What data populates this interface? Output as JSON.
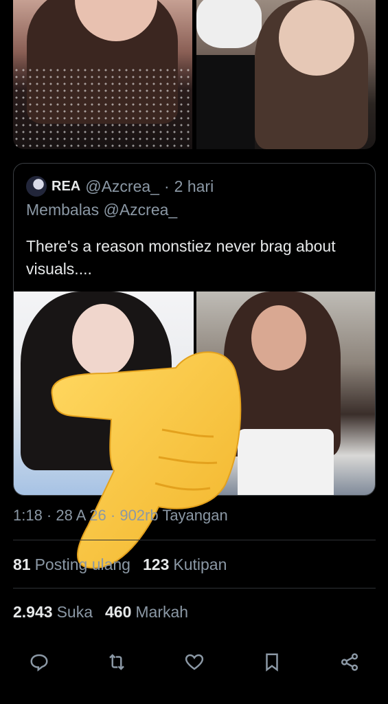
{
  "quote": {
    "display_name": "REA",
    "handle": "@Azcrea_",
    "separator": "·",
    "time": "2 hari",
    "reply_to": "Membalas @Azcrea_",
    "text": "There's a reason monstiez never brag about visuals...."
  },
  "meta": {
    "timestamp": "1:18 · 28 A   26 · 902rb Tayangan"
  },
  "stats": {
    "reposts_count": "81",
    "reposts_label": "Posting ulang",
    "quotes_count": "123",
    "quotes_label": "Kutipan",
    "likes_count": "2.943",
    "likes_label": "Suka",
    "bookmarks_count": "460",
    "bookmarks_label": "Markah"
  },
  "actions": {
    "reply_icon": "reply-icon",
    "repost_icon": "repost-icon",
    "like_icon": "heart-icon",
    "bookmark_icon": "bookmark-icon",
    "share_icon": "share-icon"
  },
  "colors": {
    "background": "#000000",
    "text_primary": "#e7e9ea",
    "text_secondary": "#8b98a5",
    "border": "#2f3336",
    "emoji_yellow": "#f7c545"
  }
}
